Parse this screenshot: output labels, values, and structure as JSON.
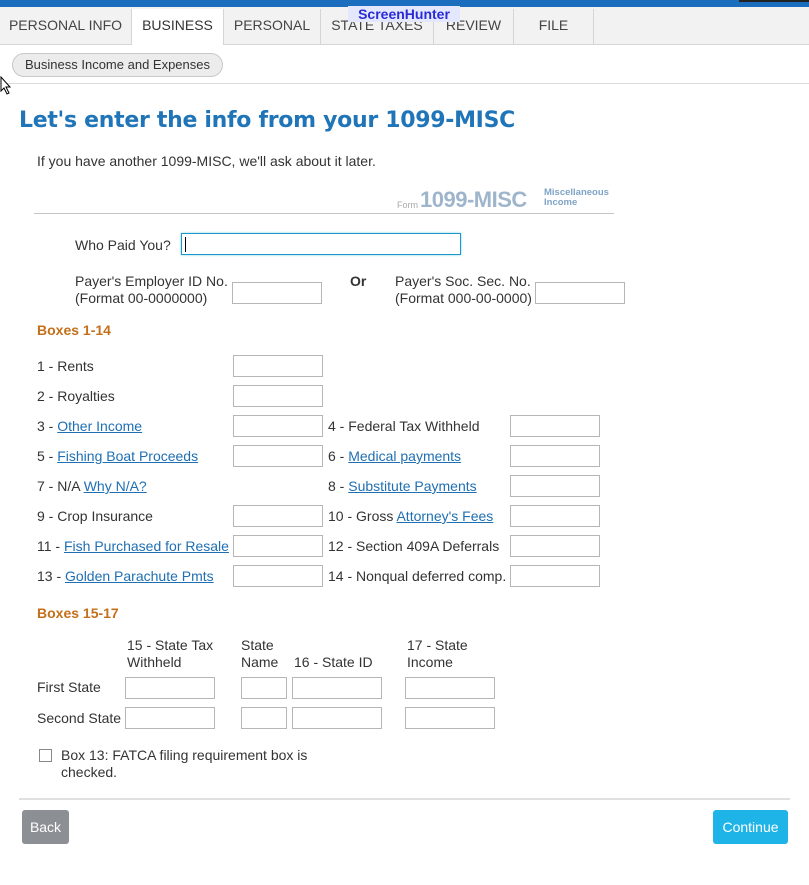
{
  "watermark": "ScreenHunter",
  "tabs": [
    {
      "label": "PERSONAL INFO"
    },
    {
      "label": "BUSINESS"
    },
    {
      "label": "PERSONAL"
    },
    {
      "label": "STATE TAXES"
    },
    {
      "label": "REVIEW"
    },
    {
      "label": "FILE"
    }
  ],
  "subnav": {
    "pill": "Business Income and Expenses"
  },
  "page": {
    "title": "Let's enter the info from your 1099-MISC",
    "intro": "If you have another 1099-MISC, we'll ask about it later."
  },
  "form_header": {
    "form_word": "Form",
    "form_number": "1099-MISC",
    "misc_line1": "Miscellaneous",
    "misc_line2": "Income"
  },
  "payer": {
    "who_paid_label": "Who Paid You?",
    "ein_label_1": "Payer's Employer ID No.",
    "ein_label_2": "(Format 00-0000000)",
    "or_label": "Or",
    "ssn_label_1": "Payer's Soc. Sec. No.",
    "ssn_label_2": "(Format 000-00-0000)"
  },
  "boxes_1_14": {
    "heading": "Boxes 1-14",
    "b1": "1 - Rents",
    "b2": "2 - Royalties",
    "b3_prefix": "3 - ",
    "b3_link": "Other Income",
    "b4": "4 - Federal Tax Withheld",
    "b5_prefix": "5 - ",
    "b5_link": "Fishing Boat Proceeds",
    "b6_prefix": "6 - ",
    "b6_link": "Medical payments",
    "b7_prefix": "7 - N/A ",
    "b7_link": "Why N/A?",
    "b8_prefix": "8 - ",
    "b8_link": "Substitute Payments",
    "b9": "9 - Crop Insurance",
    "b10_prefix": "10 - Gross ",
    "b10_link": "Attorney's Fees",
    "b11_prefix": "11 - ",
    "b11_link": "Fish Purchased for Resale",
    "b12": "12 - Section 409A Deferrals",
    "b13_prefix": "13 - ",
    "b13_link": "Golden Parachute Pmts",
    "b14": "14 - Nonqual deferred comp."
  },
  "boxes_15_17": {
    "heading": "Boxes 15-17",
    "col15_1": "15 - State Tax",
    "col15_2": "Withheld",
    "colstate_1": "State",
    "colstate_2": "Name",
    "col16": "16 - State ID",
    "col17_1": "17 - State",
    "col17_2": "Income",
    "row1": "First State",
    "row2": "Second State"
  },
  "fatca": {
    "label_1": "Box 13: FATCA filing requirement box is",
    "label_2": "checked."
  },
  "buttons": {
    "back": "Back",
    "continue": "Continue"
  }
}
